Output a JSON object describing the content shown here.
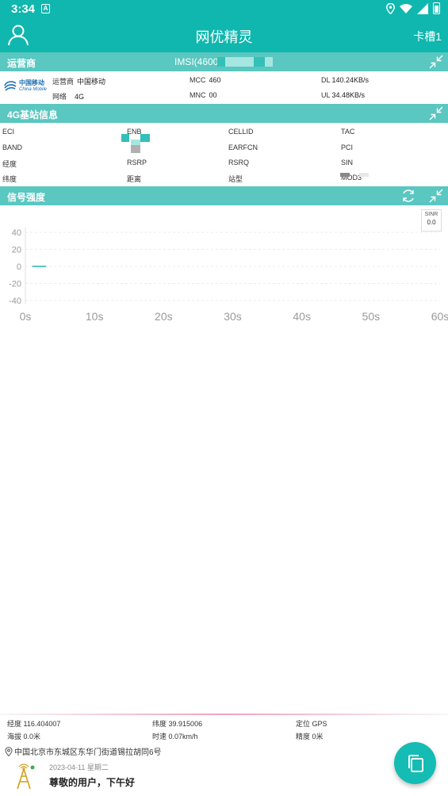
{
  "status": {
    "time": "3:34",
    "notif": "A"
  },
  "app": {
    "title": "网优精灵",
    "slot": "卡槽1"
  },
  "operator": {
    "title": "运营商",
    "imsi": "IMSI(4600",
    "logo_cn": "中国移动",
    "logo_en": "China Mobile",
    "rows": {
      "carrier_k": "运营商",
      "carrier_v": "中国移动",
      "network_k": "网络",
      "network_v": "4G",
      "mcc_k": "MCC",
      "mcc_v": "460",
      "mnc_k": "MNC",
      "mnc_v": "00",
      "dl_k": "DL",
      "dl_v": "140.24KB/s",
      "ul_k": "UL",
      "ul_v": "34.48KB/s"
    }
  },
  "cell": {
    "title": "4G基站信息",
    "labels": {
      "eci": "ECI",
      "enb": "ENB",
      "cellid": "CELLID",
      "tac": "TAC",
      "band": "BAND",
      "earfcn": "EARFCN",
      "pci": "PCI",
      "lon": "经度",
      "rsrp": "RSRP",
      "rsrq": "RSRQ",
      "sinr": "SIN",
      "lat": "纬度",
      "dist": "距离",
      "type": "站型",
      "mod": "MOD3"
    }
  },
  "signal": {
    "title": "信号强度",
    "sinr_label": "SINR",
    "sinr_value": "0.0"
  },
  "chart_data": {
    "type": "line",
    "title": "",
    "xlabel": "",
    "ylabel": "",
    "y_ticks": [
      "40",
      "20",
      "0",
      "-20",
      "-40"
    ],
    "x_ticks": [
      "0s",
      "10s",
      "20s",
      "30s",
      "40s",
      "50s",
      "60s"
    ],
    "ylim": [
      -40,
      40
    ],
    "xlim": [
      0,
      60
    ],
    "series": [
      {
        "x": [
          1,
          3
        ],
        "y": [
          0,
          0
        ],
        "color": "#5ac7c0"
      }
    ]
  },
  "location": {
    "lon_k": "经度",
    "lon_v": "116.404007",
    "lat_k": "纬度",
    "lat_v": "39.915006",
    "pos_k": "定位",
    "pos_v": "GPS",
    "alt_k": "海拔",
    "alt_v": "0.0米",
    "speed_k": "时速",
    "speed_v": "0.07km/h",
    "acc_k": "精度",
    "acc_v": "0米",
    "address": "中国北京市东城区东华门街道锡拉胡同6号",
    "date": "2023-04-11  星期二",
    "greeting": "尊敬的用户，下午好"
  },
  "colors": {
    "primary": "#10b7ae",
    "section": "#5ac7c0",
    "fab": "#14bcb3"
  }
}
